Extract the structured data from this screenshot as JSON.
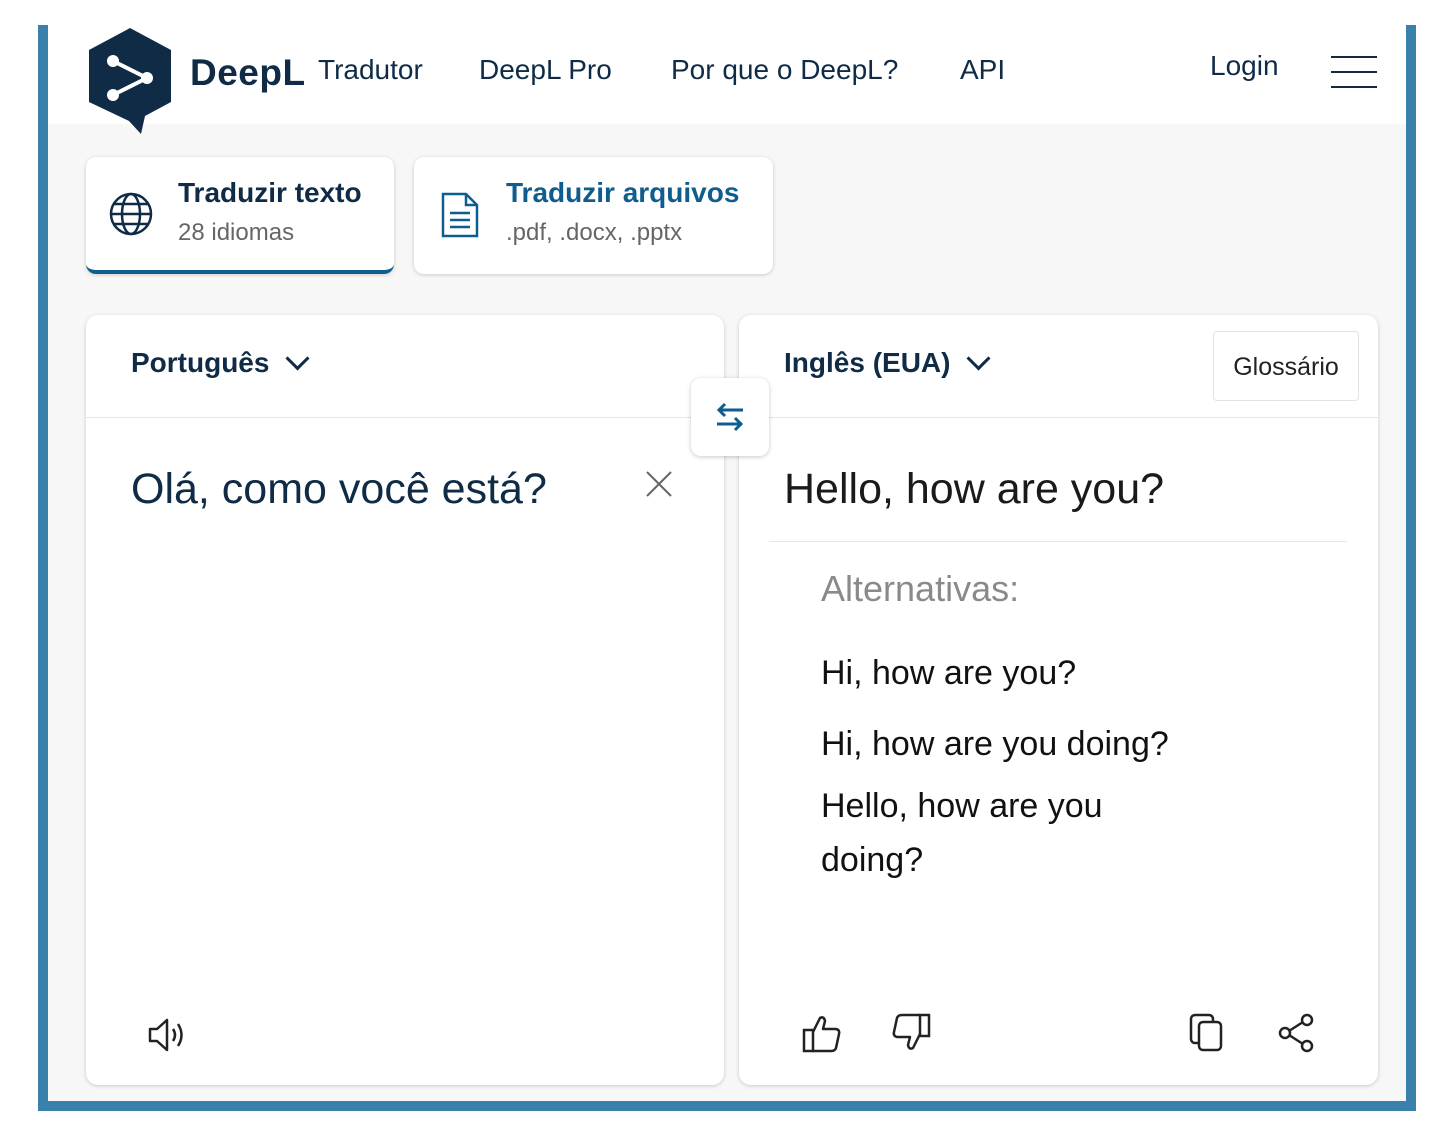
{
  "header": {
    "brand": "DeepL",
    "product": "Tradutor",
    "nav": [
      "DeepL Pro",
      "Por que o DeepL?",
      "API"
    ],
    "login": "Login"
  },
  "modes": {
    "text": {
      "title": "Traduzir texto",
      "subtitle": "28 idiomas",
      "active": true
    },
    "files": {
      "title": "Traduzir arquivos",
      "subtitle": ".pdf, .docx, .pptx"
    }
  },
  "source": {
    "language": "Português",
    "text": "Olá, como você está?"
  },
  "target": {
    "language": "Inglês (EUA)",
    "glossary": "Glossário",
    "text": "Hello, how are you?",
    "alternatives_label": "Alternativas:",
    "alternatives": [
      "Hi, how are you?",
      "Hi, how are you doing?",
      "Hello, how are you doing?"
    ]
  },
  "colors": {
    "brand": "#0f2b46",
    "accent": "#0f5d8f",
    "frame": "#3a80ad"
  },
  "icons": {
    "logo": "deepl-logo",
    "text_mode": "globe-icon",
    "files_mode": "document-icon",
    "swap": "swap-icon",
    "clear": "close-icon",
    "listen": "speaker-icon",
    "like": "thumbs-up-icon",
    "dislike": "thumbs-down-icon",
    "copy": "copy-icon",
    "share": "share-icon",
    "menu": "hamburger-menu-icon"
  }
}
